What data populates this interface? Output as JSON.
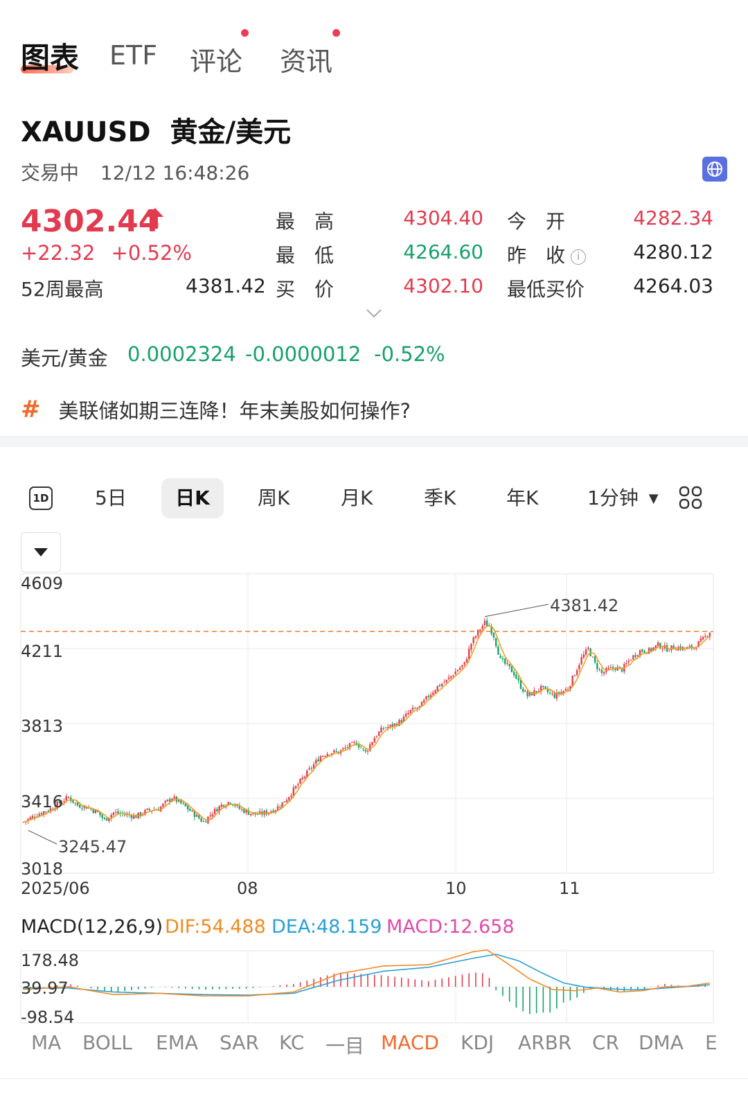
{
  "tabs": [
    {
      "label": "图表",
      "active": true
    },
    {
      "label": "ETF",
      "active": false
    },
    {
      "label": "评论",
      "active": false,
      "dot": true
    },
    {
      "label": "资讯",
      "active": false,
      "dot": true
    }
  ],
  "instrument": {
    "code": "XAUUSD",
    "name": "黄金/美元"
  },
  "status": {
    "state": "交易中",
    "time": "12/12 16:48:26"
  },
  "quote": {
    "price": "4302.44",
    "change": "+22.32",
    "change_pct": "+0.52%",
    "week52_high_label": "52周最高",
    "week52_high": "4381.42",
    "high_label": "最　高",
    "high": "4304.40",
    "low_label": "最　低",
    "low": "4264.60",
    "bid_label": "买　价",
    "bid": "4302.10",
    "open_label": "今　开",
    "open": "4282.34",
    "prev_close_label": "昨　收",
    "prev_close": "4280.12",
    "lowest_bid_label": "最低买价",
    "lowest_bid": "4264.03",
    "info_glyph": "i"
  },
  "inverse": {
    "label": "美元/黄金",
    "price": "0.0002324",
    "change": "-0.0000012",
    "change_pct": "-0.52%"
  },
  "news": {
    "icon": "#",
    "text": "美联储如期三连降！年末美股如何操作?"
  },
  "periods": {
    "icon_label": "1D",
    "items": [
      {
        "label": "5日",
        "active": false
      },
      {
        "label": "日K",
        "active": true
      },
      {
        "label": "周K",
        "active": false
      },
      {
        "label": "月K",
        "active": false
      },
      {
        "label": "季K",
        "active": false
      },
      {
        "label": "年K",
        "active": false
      }
    ],
    "minute": "1分钟"
  },
  "chart_data": {
    "type": "candlestick",
    "y_ticks": [
      "4609",
      "4211",
      "3813",
      "3416",
      "3018"
    ],
    "ylim": [
      3018,
      4609
    ],
    "x_ticks": [
      "2025/06",
      "08",
      "10",
      "11"
    ],
    "annotations": {
      "high": "4381.42",
      "low": "3245.47"
    },
    "reference_price": 4302.44,
    "grid": true,
    "colors": {
      "up": "#e23a4e",
      "down": "#16a06a",
      "ma": "#f0a020",
      "ref_line": "#f07a2a"
    },
    "close_path": [
      [
        0,
        3290
      ],
      [
        6,
        3330
      ],
      [
        12,
        3360
      ],
      [
        17,
        3400
      ],
      [
        20,
        3420
      ],
      [
        24,
        3380
      ],
      [
        28,
        3370
      ],
      [
        33,
        3340
      ],
      [
        36,
        3300
      ],
      [
        40,
        3340
      ],
      [
        45,
        3330
      ],
      [
        50,
        3320
      ],
      [
        55,
        3350
      ],
      [
        60,
        3360
      ],
      [
        66,
        3420
      ],
      [
        71,
        3380
      ],
      [
        76,
        3330
      ],
      [
        80,
        3290
      ],
      [
        84,
        3340
      ],
      [
        88,
        3380
      ],
      [
        92,
        3400
      ],
      [
        96,
        3360
      ],
      [
        100,
        3340
      ],
      [
        104,
        3330
      ],
      [
        108,
        3340
      ],
      [
        112,
        3360
      ],
      [
        116,
        3400
      ],
      [
        120,
        3460
      ],
      [
        124,
        3520
      ],
      [
        128,
        3580
      ],
      [
        132,
        3640
      ],
      [
        136,
        3660
      ],
      [
        140,
        3660
      ],
      [
        144,
        3690
      ],
      [
        148,
        3710
      ],
      [
        152,
        3660
      ],
      [
        156,
        3740
      ],
      [
        160,
        3790
      ],
      [
        164,
        3800
      ],
      [
        168,
        3830
      ],
      [
        172,
        3880
      ],
      [
        176,
        3900
      ],
      [
        180,
        3960
      ],
      [
        184,
        4010
      ],
      [
        188,
        4040
      ],
      [
        192,
        4090
      ],
      [
        196,
        4130
      ],
      [
        199,
        4240
      ],
      [
        202,
        4300
      ],
      [
        205,
        4350
      ],
      [
        207,
        4330
      ],
      [
        209,
        4280
      ],
      [
        212,
        4150
      ],
      [
        215,
        4120
      ],
      [
        218,
        4080
      ],
      [
        221,
        4010
      ],
      [
        224,
        3960
      ],
      [
        227,
        3980
      ],
      [
        230,
        4000
      ],
      [
        233,
        3980
      ],
      [
        236,
        3960
      ],
      [
        239,
        3980
      ],
      [
        242,
        4000
      ],
      [
        245,
        4080
      ],
      [
        248,
        4160
      ],
      [
        251,
        4210
      ],
      [
        254,
        4130
      ],
      [
        257,
        4080
      ],
      [
        260,
        4100
      ],
      [
        263,
        4110
      ],
      [
        266,
        4100
      ],
      [
        270,
        4160
      ],
      [
        274,
        4200
      ],
      [
        278,
        4200
      ],
      [
        282,
        4230
      ],
      [
        286,
        4210
      ],
      [
        290,
        4220
      ],
      [
        294,
        4210
      ],
      [
        298,
        4220
      ],
      [
        302,
        4260
      ],
      [
        305,
        4302
      ]
    ],
    "macd": {
      "params": "MACD(12,26,9)",
      "dif_label": "DIF:54.488",
      "dea_label": "DEA:48.159",
      "macd_label": "MACD:12.658",
      "y_ticks": [
        "178.48",
        "39.97",
        "-98.54"
      ],
      "ylim": [
        -98.54,
        178.48
      ],
      "colors": {
        "dif": "#f08a24",
        "dea": "#2a9fd8",
        "macd": "#e04aa8"
      },
      "dif": [
        [
          0,
          30
        ],
        [
          20,
          40
        ],
        [
          40,
          10
        ],
        [
          60,
          15
        ],
        [
          80,
          5
        ],
        [
          100,
          5
        ],
        [
          120,
          20
        ],
        [
          140,
          90
        ],
        [
          160,
          120
        ],
        [
          180,
          125
        ],
        [
          200,
          175
        ],
        [
          206,
          182
        ],
        [
          215,
          130
        ],
        [
          225,
          70
        ],
        [
          235,
          30
        ],
        [
          245,
          25
        ],
        [
          255,
          35
        ],
        [
          265,
          20
        ],
        [
          275,
          25
        ],
        [
          285,
          40
        ],
        [
          295,
          42
        ],
        [
          305,
          54.488
        ]
      ],
      "dea": [
        [
          0,
          35
        ],
        [
          20,
          35
        ],
        [
          40,
          20
        ],
        [
          60,
          15
        ],
        [
          80,
          10
        ],
        [
          100,
          8
        ],
        [
          120,
          15
        ],
        [
          140,
          65
        ],
        [
          160,
          100
        ],
        [
          180,
          115
        ],
        [
          200,
          150
        ],
        [
          210,
          165
        ],
        [
          220,
          140
        ],
        [
          230,
          95
        ],
        [
          240,
          55
        ],
        [
          250,
          38
        ],
        [
          260,
          33
        ],
        [
          270,
          28
        ],
        [
          280,
          32
        ],
        [
          290,
          38
        ],
        [
          300,
          44
        ],
        [
          305,
          48.159
        ]
      ]
    }
  },
  "indicators": {
    "items": [
      "MA",
      "BOLL",
      "EMA",
      "SAR",
      "KC",
      "一目",
      "MACD",
      "KDJ",
      "ARBR",
      "CR",
      "DMA",
      "E"
    ],
    "active": "MACD"
  }
}
